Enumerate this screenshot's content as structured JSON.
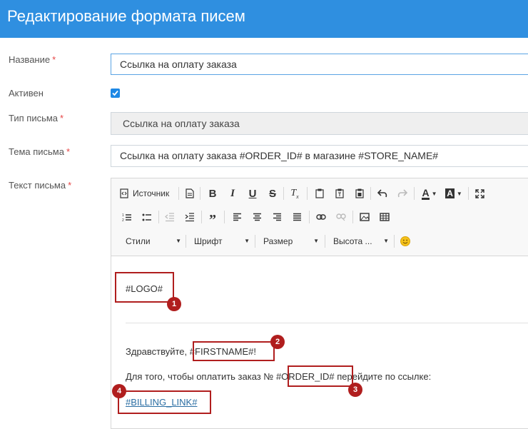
{
  "header": {
    "title": "Редактирование формата писем"
  },
  "form": {
    "name": {
      "label": "Название",
      "value": "Ссылка на оплату заказа"
    },
    "active": {
      "label": "Активен",
      "checked": true
    },
    "type": {
      "label": "Тип письма",
      "value": "Ссылка на оплату заказа"
    },
    "subject": {
      "label": "Тема письма",
      "value": "Ссылка на оплату заказа #ORDER_ID# в магазине #STORE_NAME#"
    },
    "body": {
      "label": "Текст письма"
    },
    "required_mark": "*"
  },
  "toolbar": {
    "source_label": "Источник",
    "styles": "Стили",
    "font": "Шрифт",
    "size": "Размер",
    "height": "Высота ..."
  },
  "content": {
    "logo": "#LOGO#",
    "greeting": "Здравствуйте,",
    "firstname": "#FIRSTNAME#!",
    "pay_before": "Для того, чтобы оплатить заказ №",
    "order_id": "#ORDER_ID#",
    "pay_after": "перейдите по ссылке:",
    "billing_link": "#BILLING_LINK#"
  },
  "callouts": [
    "1",
    "2",
    "3",
    "4"
  ],
  "colors": {
    "header": "#2f8fe0",
    "callout": "#b01e1e",
    "link": "#2b6ea3",
    "checkbox": "#1e88e5"
  }
}
